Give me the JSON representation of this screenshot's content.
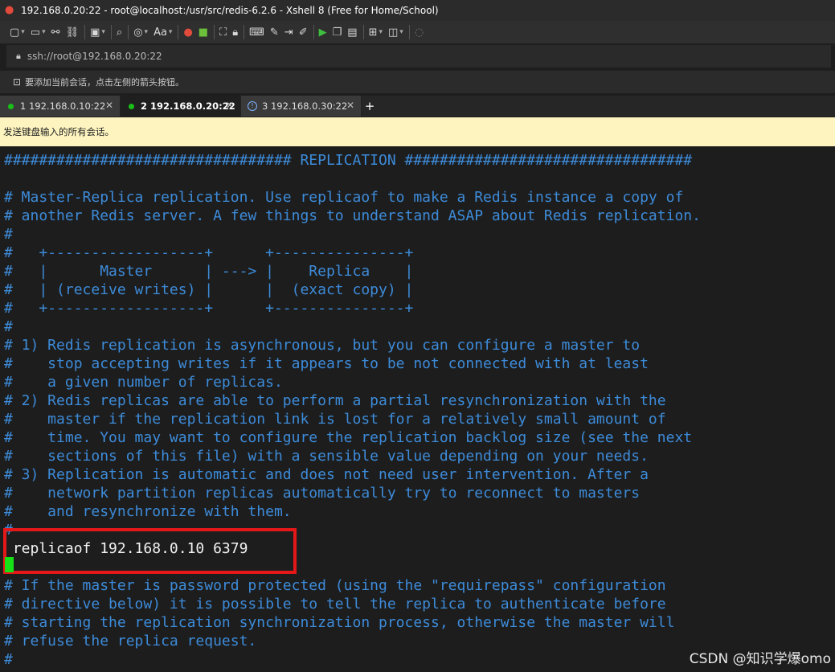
{
  "window": {
    "title": "192.168.0.20:22 - root@localhost:/usr/src/redis-6.2.6 - Xshell 8 (Free for Home/School)"
  },
  "toolbar": {
    "font_label": "Aa"
  },
  "address": {
    "url": "ssh://root@192.168.0.20:22"
  },
  "hint": {
    "text": "要添加当前会话，点击左侧的箭头按钮。"
  },
  "tabs": [
    {
      "label": "1 192.168.0.10:22",
      "status": "connected",
      "active": false
    },
    {
      "label": "2 192.168.0.20:22",
      "status": "connected",
      "active": true
    },
    {
      "label": "3 192.168.0.30:22",
      "status": "info",
      "active": false
    }
  ],
  "tab_add": "+",
  "banner": {
    "text": "发送键盘输入的所有会话。"
  },
  "terminal": {
    "lines": [
      "################################# REPLICATION #################################",
      "",
      "# Master-Replica replication. Use replicaof to make a Redis instance a copy of",
      "# another Redis server. A few things to understand ASAP about Redis replication.",
      "#",
      "#   +------------------+      +---------------+",
      "#   |      Master      | ---> |    Replica    |",
      "#   | (receive writes) |      |  (exact copy) |",
      "#   +------------------+      +---------------+",
      "#",
      "# 1) Redis replication is asynchronous, but you can configure a master to",
      "#    stop accepting writes if it appears to be not connected with at least",
      "#    a given number of replicas.",
      "# 2) Redis replicas are able to perform a partial resynchronization with the",
      "#    master if the replication link is lost for a relatively small amount of",
      "#    time. You may want to configure the replication backlog size (see the next",
      "#    sections of this file) with a sensible value depending on your needs.",
      "# 3) Replication is automatic and does not need user intervention. After a",
      "#    network partition replicas automatically try to reconnect to masters",
      "#    and resynchronize with them.",
      "#",
      " replicaof 192.168.0.10 6379",
      "",
      "# If the master is password protected (using the \"requirepass\" configuration",
      "# directive below) it is possible to tell the replica to authenticate before",
      "# starting the replication synchronization process, otherwise the master will",
      "# refuse the replica request.",
      "#"
    ],
    "highlighted_line": " replicaof 192.168.0.10 6379"
  },
  "watermark": "CSDN @知识学爆omo",
  "colors": {
    "comment": "#3d8bd9",
    "plain": "#f2f2f2",
    "highlight_border": "#e41818",
    "cursor": "#16e016",
    "banner": "#fdf4bf"
  }
}
